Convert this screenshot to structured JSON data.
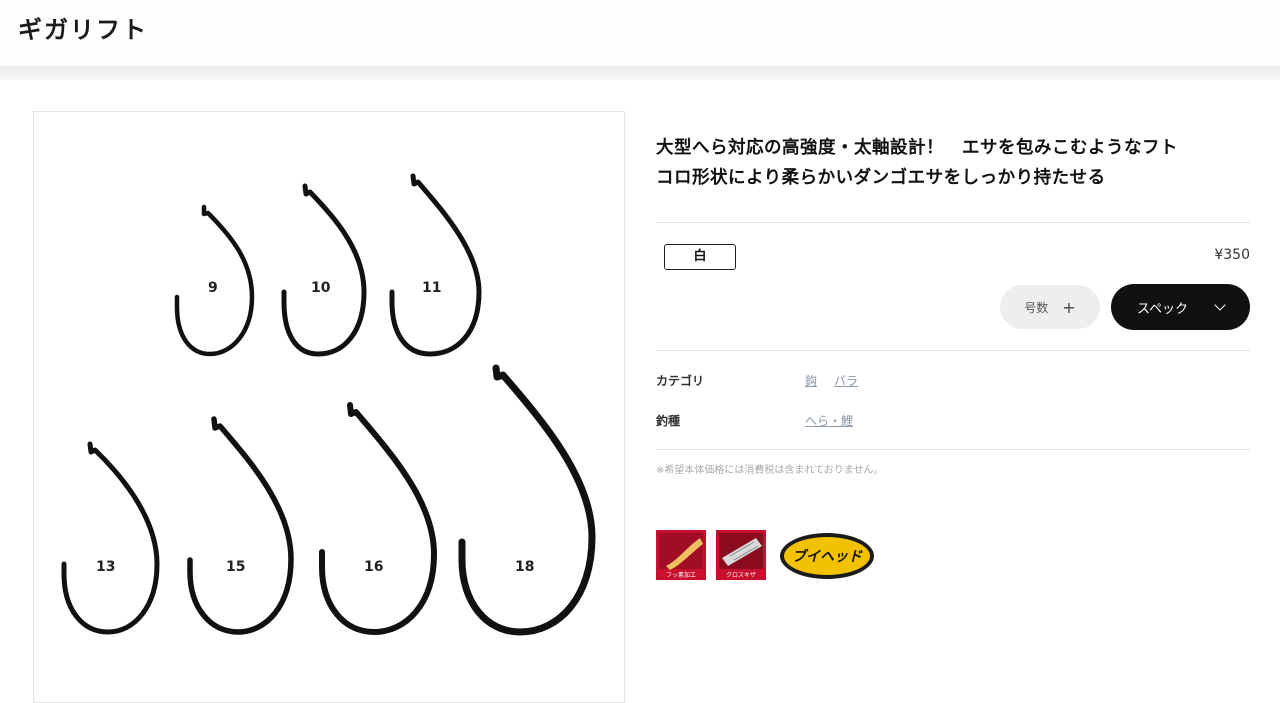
{
  "header": {
    "title": "ギガリフト"
  },
  "product": {
    "headline_line1": "大型へら対応の高強度・太軸設計！　エサを包みこむようなフト",
    "headline_line2": "コロ形状により柔らかいダンゴエサをしっかり持たせる",
    "color_option": "白",
    "price": "¥350",
    "quantity_label": "号数",
    "quantity_icon": "plus-icon",
    "spec_label": "スペック",
    "spec_icon": "chevron-down-icon"
  },
  "meta": {
    "category_label": "カテゴリ",
    "category_links": [
      "鈎",
      "バラ"
    ],
    "fishing_label": "釣種",
    "fishing_link": "へら・鯉"
  },
  "note": "※希望本体価格には消費税は含まれておりません。",
  "hook_sizes": [
    "9",
    "10",
    "11",
    "13",
    "15",
    "16",
    "18"
  ],
  "badges": [
    {
      "name": "fluoro-coat-badge",
      "caption": "フッ素加工"
    },
    {
      "name": "cross-kizu-badge",
      "caption": "クロスキザ"
    },
    {
      "name": "v-head-badge",
      "text": "ブイヘッド"
    }
  ],
  "colors": {
    "spec_button": "#111111",
    "badge_red": "#c8102e",
    "badge_gold": "#f2c200"
  }
}
